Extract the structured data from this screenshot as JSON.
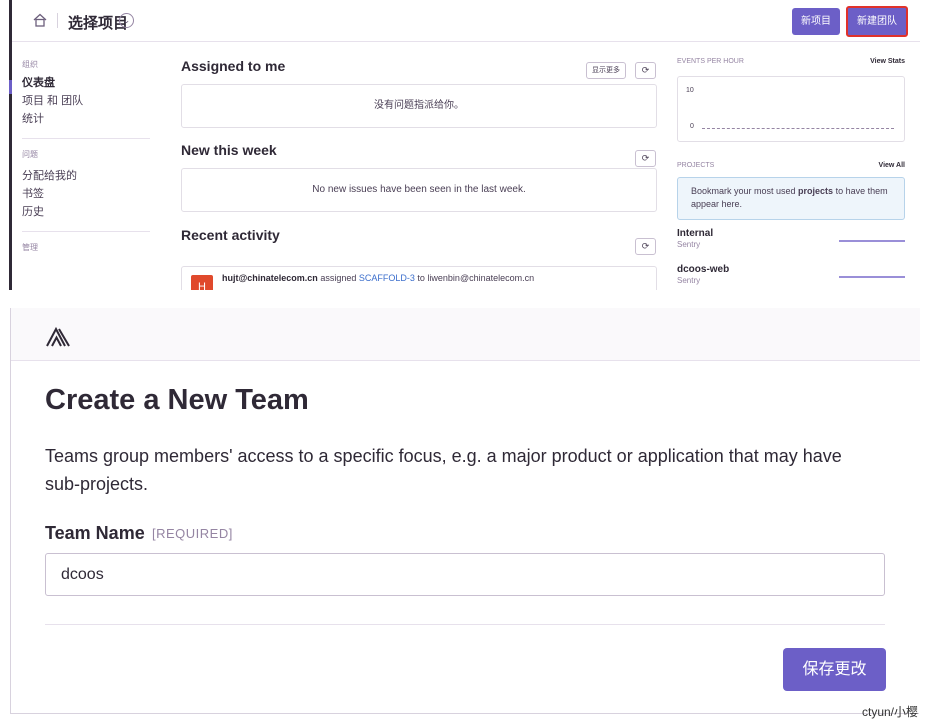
{
  "dashboard": {
    "header": {
      "title": "选择项目",
      "new_project_label": "新项目",
      "new_team_label": "新建团队"
    },
    "sidebar": {
      "sections": [
        {
          "heading": "组织",
          "items": [
            "仪表盘",
            "项目 和 团队",
            "统计"
          ]
        },
        {
          "heading": "问题",
          "items": [
            "分配给我的",
            "书签",
            "历史"
          ]
        },
        {
          "heading": "管理",
          "items": []
        }
      ]
    },
    "assigned": {
      "title": "Assigned to me",
      "show_more_label": "显示更多",
      "empty_text": "没有问题指派给你。"
    },
    "new_this_week": {
      "title": "New this week",
      "empty_text": "No new issues have been seen in the last week."
    },
    "recent_activity": {
      "title": "Recent activity",
      "avatar_letter": "H",
      "user": "hujt@chinatelecom.cn",
      "verb": "assigned",
      "issue": "SCAFFOLD-3",
      "to_word": "to",
      "assignee": "liwenbin@chinatelecom.cn"
    },
    "events": {
      "heading": "EVENTS PER HOUR",
      "link": "View Stats",
      "max_label": "10",
      "min_label": "0"
    },
    "projects": {
      "heading": "PROJECTS",
      "link": "View All",
      "bookmark_pre": "Bookmark your most used ",
      "bookmark_bold": "projects",
      "bookmark_post": " to have them appear here.",
      "list": [
        {
          "name": "Internal",
          "org": "Sentry"
        },
        {
          "name": "dcoos-web",
          "org": "Sentry"
        }
      ]
    }
  },
  "create_team": {
    "title": "Create a New Team",
    "description": "Teams group members' access to a specific focus, e.g. a major product or application that may have sub-projects.",
    "field_label": "Team Name",
    "field_required": "[REQUIRED]",
    "field_value": "dcoos",
    "save_label": "保存更改"
  },
  "watermark": "ctyun/小樱",
  "colors": {
    "accent": "#6c5fc7",
    "highlight": "#e0322b"
  },
  "icons": [
    "home-icon",
    "chevron-down-icon",
    "refresh-icon",
    "sentry-logo-icon"
  ]
}
